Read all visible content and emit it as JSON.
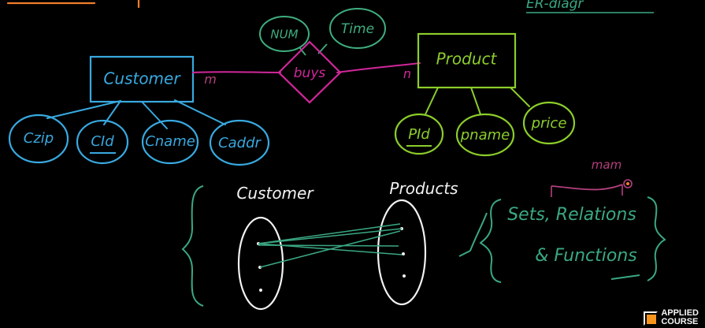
{
  "colors": {
    "background": "#000000",
    "customer": "#39a9e0",
    "relationship": "#d0279a",
    "product": "#8ccd2b",
    "relation_attr": "#3fae7f",
    "white": "#f2f2f2",
    "sets": "#3aa882",
    "mapping": "#b3407e",
    "corner": "#f07d2a"
  },
  "er_diagram": {
    "entity_customer": "Customer",
    "relationship": "buys",
    "entity_product": "Product",
    "cardinality_left": "m",
    "cardinality_right": "n",
    "relationship_attributes": [
      "NUM",
      "Time"
    ],
    "customer_attributes": [
      "Czip",
      "CId",
      "Cname",
      "Caddr"
    ],
    "product_attributes": [
      "PId",
      "pname",
      "price"
    ],
    "heading_partial": "ER-diagr"
  },
  "mapping_sketch": {
    "left_set_label": "Customer",
    "right_set_label": "Products",
    "annotation_line1": "Sets, Relations",
    "annotation_line2": "& Functions",
    "annotation_above": "mam"
  },
  "branding": {
    "line1": "APPLIED",
    "line2": "COURSE"
  }
}
